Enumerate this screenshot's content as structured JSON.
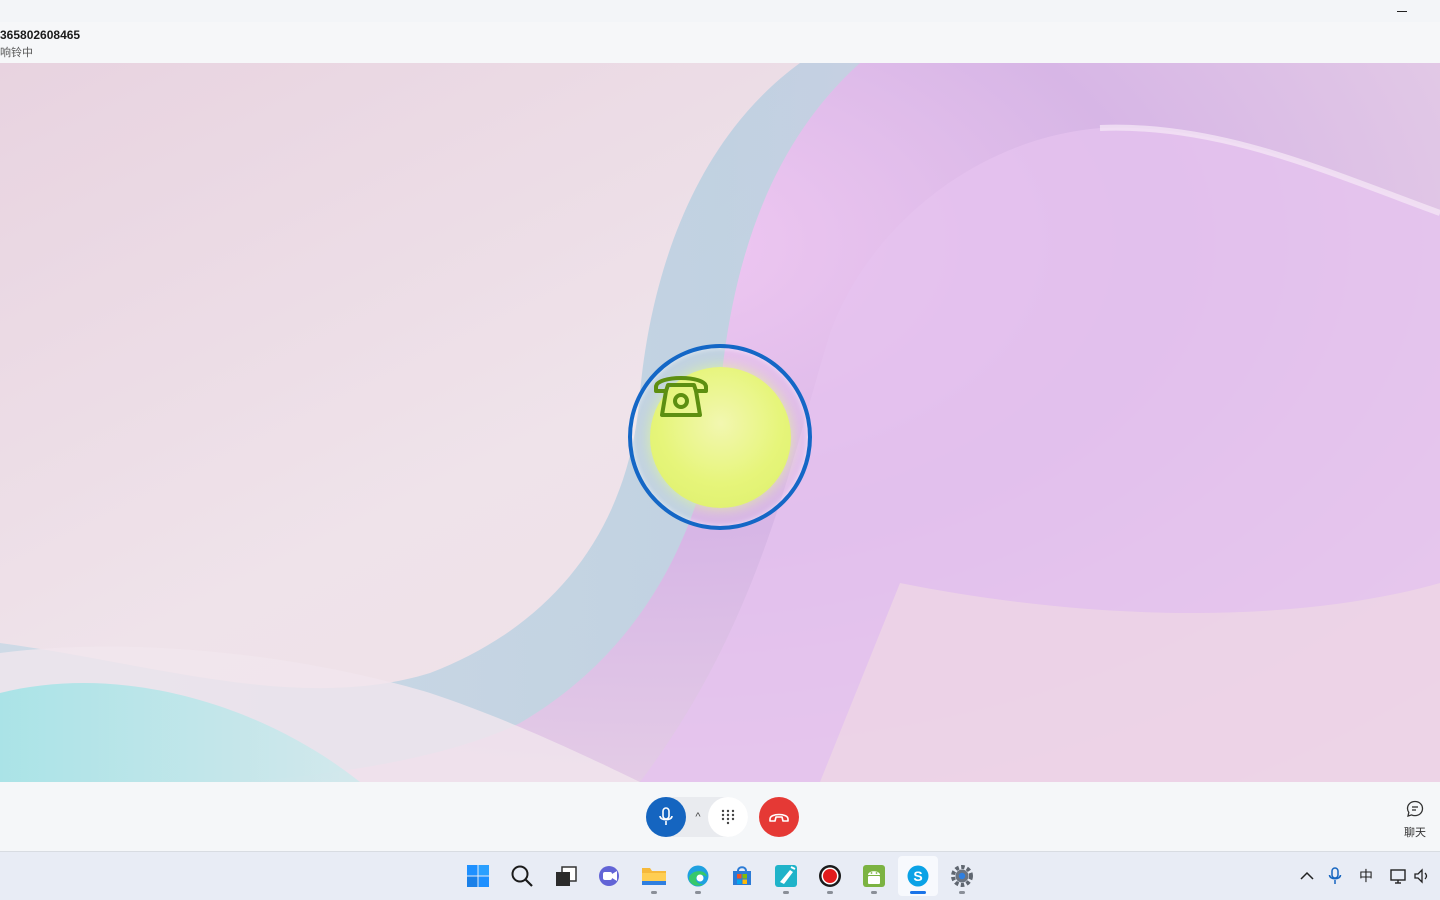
{
  "window": {
    "minimize_label": "—"
  },
  "call": {
    "number": "365802608465",
    "status": "响铃中",
    "caller_icon": "rotary-phone-icon",
    "ring_color": "#1467c6",
    "orb_color": "#e3f47a"
  },
  "controls": {
    "mic_icon": "microphone-icon",
    "mic_color": "#1565c0",
    "mic_options_label": "^",
    "dialpad_icon": "dialpad-icon",
    "hangup_icon": "hang-up-icon",
    "hangup_color": "#e53935",
    "chat_icon": "chat-bubble-icon",
    "chat_label": "聊天"
  },
  "taskbar": {
    "apps": [
      {
        "name": "start",
        "icon": "windows-start-icon"
      },
      {
        "name": "search",
        "icon": "search-icon"
      },
      {
        "name": "task-view",
        "icon": "task-view-icon"
      },
      {
        "name": "teams",
        "icon": "teams-chat-icon"
      },
      {
        "name": "file-explorer",
        "icon": "folder-icon"
      },
      {
        "name": "edge",
        "icon": "edge-browser-icon"
      },
      {
        "name": "store",
        "icon": "microsoft-store-icon"
      },
      {
        "name": "app-cleaner",
        "icon": "broom-app-icon"
      },
      {
        "name": "recorder",
        "icon": "record-icon"
      },
      {
        "name": "android",
        "icon": "android-icon"
      },
      {
        "name": "skype",
        "icon": "skype-icon"
      },
      {
        "name": "settings",
        "icon": "settings-gear-icon"
      }
    ],
    "tray": {
      "overflow_label": "^",
      "ime_label": "中"
    }
  }
}
